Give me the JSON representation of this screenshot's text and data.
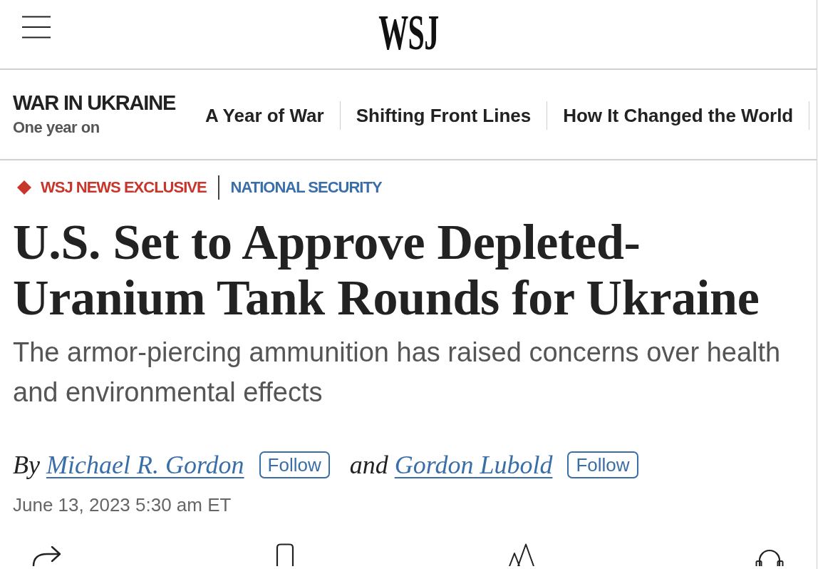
{
  "header": {
    "logo": "WSJ"
  },
  "section_nav": {
    "title": "WAR IN UKRAINE",
    "subtitle": "One year on",
    "links": [
      {
        "label": "A Year of War"
      },
      {
        "label": "Shifting Front Lines"
      },
      {
        "label": "How It Changed the World"
      }
    ]
  },
  "article": {
    "flags": [
      {
        "kind": "exclusive",
        "label": "WSJ NEWS EXCLUSIVE"
      },
      {
        "kind": "section",
        "label": "NATIONAL SECURITY"
      }
    ],
    "headline": "U.S. Set to Approve Depleted-Uranium Tank Rounds for Ukraine",
    "dek": "The armor-piercing ammunition has raised concerns over health and environmental effects",
    "byline": [
      {
        "kind": "text",
        "text": "By"
      },
      {
        "kind": "author",
        "name": "Michael R. Gordon",
        "follow_label": "Follow"
      },
      {
        "kind": "text",
        "text": "and"
      },
      {
        "kind": "author",
        "name": "Gordon Lubold",
        "follow_label": "Follow"
      }
    ],
    "timestamp": "June 13, 2023 5:30 am ET"
  }
}
